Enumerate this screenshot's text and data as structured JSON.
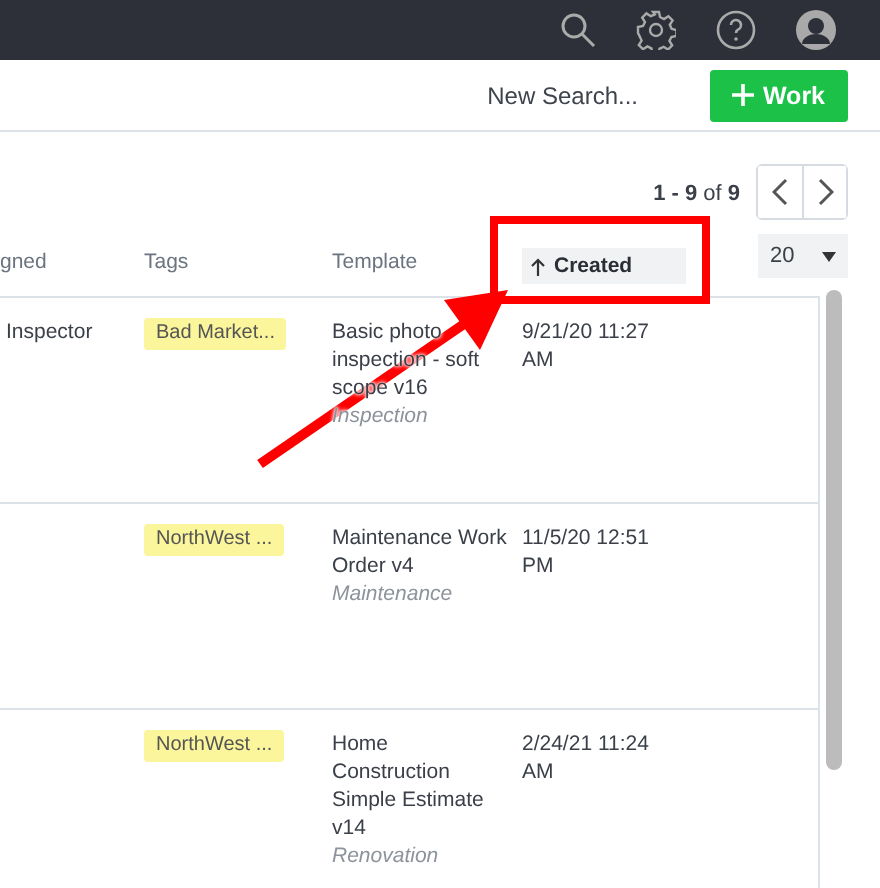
{
  "toolbar": {
    "new_search": "New Search...",
    "add_button": "Work"
  },
  "pagination": {
    "range": "**1 - 9** of **9**",
    "page_size": "20"
  },
  "columns": [
    {
      "label": "gned",
      "sorted": false
    },
    {
      "label": "Tags",
      "sorted": false
    },
    {
      "label": "Template",
      "sorted": false
    },
    {
      "label": "Created",
      "sorted": true
    }
  ],
  "rows": [
    {
      "assignee": "Inspector",
      "tag": "Bad Market...",
      "template": "Basic photo inspection - soft scope v16",
      "category": "Inspection",
      "created": "9/21/20 11:27 AM"
    },
    {
      "tag": "NorthWest ...",
      "template": "Maintenance Work Order v4",
      "category": "Maintenance",
      "created": "11/5/20 12:51 PM"
    },
    {
      "tag": "NorthWest ...",
      "template": "Home Construction Simple Estimate v14",
      "category": "Renovation",
      "created": "2/24/21 11:24 AM"
    }
  ]
}
